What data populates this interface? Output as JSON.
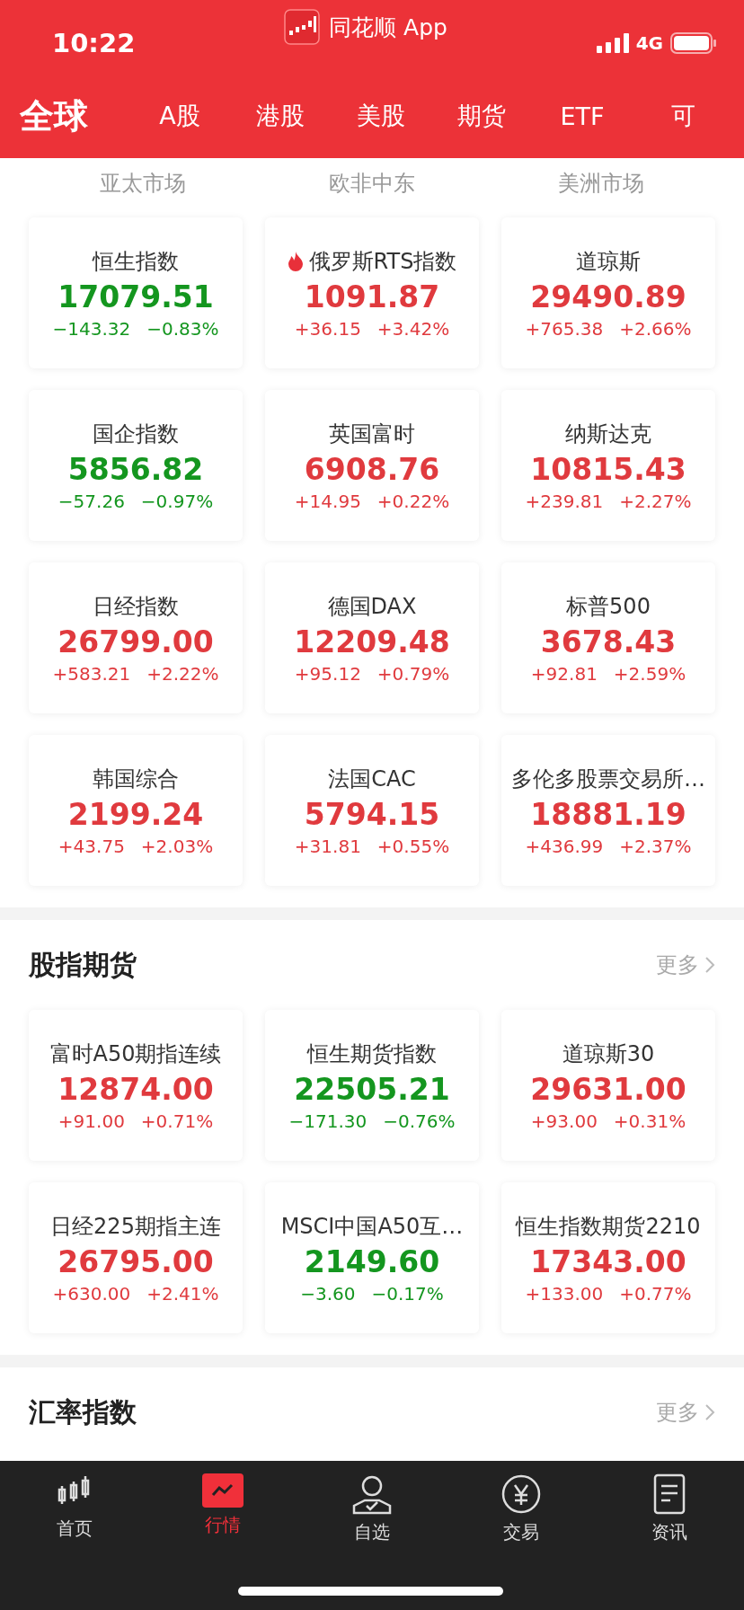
{
  "status_bar": {
    "time": "10:22",
    "app_name": "同花顺 App",
    "network": "4G"
  },
  "tabs": [
    {
      "label": "全球",
      "selected": true
    },
    {
      "label": "A股",
      "selected": false
    },
    {
      "label": "港股",
      "selected": false
    },
    {
      "label": "美股",
      "selected": false
    },
    {
      "label": "期货",
      "selected": false
    },
    {
      "label": "ETF",
      "selected": false
    },
    {
      "label": "可",
      "selected": false
    }
  ],
  "regions": [
    "亚太市场",
    "欧非中东",
    "美洲市场"
  ],
  "global_indices": [
    {
      "name": "恒生指数",
      "price": "17079.51",
      "change": "−143.32",
      "percent": "−0.83%",
      "up": false,
      "hot": false
    },
    {
      "name": "俄罗斯RTS指数",
      "price": "1091.87",
      "change": "+36.15",
      "percent": "+3.42%",
      "up": true,
      "hot": true
    },
    {
      "name": "道琼斯",
      "price": "29490.89",
      "change": "+765.38",
      "percent": "+2.66%",
      "up": true,
      "hot": false
    },
    {
      "name": "国企指数",
      "price": "5856.82",
      "change": "−57.26",
      "percent": "−0.97%",
      "up": false,
      "hot": false
    },
    {
      "name": "英国富时",
      "price": "6908.76",
      "change": "+14.95",
      "percent": "+0.22%",
      "up": true,
      "hot": false
    },
    {
      "name": "纳斯达克",
      "price": "10815.43",
      "change": "+239.81",
      "percent": "+2.27%",
      "up": true,
      "hot": false
    },
    {
      "name": "日经指数",
      "price": "26799.00",
      "change": "+583.21",
      "percent": "+2.22%",
      "up": true,
      "hot": false
    },
    {
      "name": "德国DAX",
      "price": "12209.48",
      "change": "+95.12",
      "percent": "+0.79%",
      "up": true,
      "hot": false
    },
    {
      "name": "标普500",
      "price": "3678.43",
      "change": "+92.81",
      "percent": "+2.59%",
      "up": true,
      "hot": false
    },
    {
      "name": "韩国综合",
      "price": "2199.24",
      "change": "+43.75",
      "percent": "+2.03%",
      "up": true,
      "hot": false
    },
    {
      "name": "法国CAC",
      "price": "5794.15",
      "change": "+31.81",
      "percent": "+0.55%",
      "up": true,
      "hot": false
    },
    {
      "name": "多伦多股票交易所…",
      "price": "18881.19",
      "change": "+436.99",
      "percent": "+2.37%",
      "up": true,
      "hot": false
    }
  ],
  "futures_section": {
    "title": "股指期货",
    "more": "更多",
    "items": [
      {
        "name": "富时A50期指连续",
        "price": "12874.00",
        "change": "+91.00",
        "percent": "+0.71%",
        "up": true,
        "hot": false
      },
      {
        "name": "恒生期货指数",
        "price": "22505.21",
        "change": "−171.30",
        "percent": "−0.76%",
        "up": false,
        "hot": false
      },
      {
        "name": "道琼斯30",
        "price": "29631.00",
        "change": "+93.00",
        "percent": "+0.31%",
        "up": true,
        "hot": false
      },
      {
        "name": "日经225期指主连",
        "price": "26795.00",
        "change": "+630.00",
        "percent": "+2.41%",
        "up": true,
        "hot": false
      },
      {
        "name": "MSCI中国A50互…",
        "price": "2149.60",
        "change": "−3.60",
        "percent": "−0.17%",
        "up": false,
        "hot": false
      },
      {
        "name": "恒生指数期货2210",
        "price": "17343.00",
        "change": "+133.00",
        "percent": "+0.77%",
        "up": true,
        "hot": false
      }
    ]
  },
  "fx_section": {
    "title": "汇率指数",
    "more": "更多"
  },
  "bottom_nav": [
    {
      "label": "首页",
      "kind": "candles",
      "selected": false
    },
    {
      "label": "行情",
      "kind": "chart",
      "selected": true
    },
    {
      "label": "自选",
      "kind": "person",
      "selected": false
    },
    {
      "label": "交易",
      "kind": "yen",
      "selected": false
    },
    {
      "label": "资讯",
      "kind": "doc",
      "selected": false
    }
  ]
}
